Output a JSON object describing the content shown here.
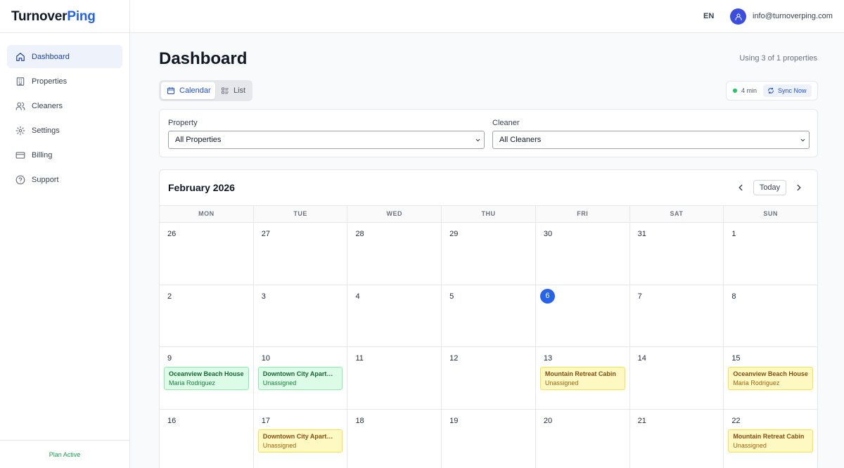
{
  "brand": {
    "part1": "Turnover",
    "part2": "Ping",
    "accent": "#2563eb"
  },
  "sidebar": {
    "items": [
      {
        "label": "Dashboard",
        "icon": "home-icon",
        "active": true
      },
      {
        "label": "Properties",
        "icon": "building-icon",
        "active": false
      },
      {
        "label": "Cleaners",
        "icon": "users-icon",
        "active": false
      },
      {
        "label": "Settings",
        "icon": "gear-icon",
        "active": false
      },
      {
        "label": "Billing",
        "icon": "credit-card-icon",
        "active": false
      },
      {
        "label": "Support",
        "icon": "help-circle-icon",
        "active": false
      }
    ],
    "footer": "Plan Active"
  },
  "header": {
    "language": "EN",
    "email": "info@turnoverping.com"
  },
  "main": {
    "title": "Dashboard",
    "usage": "Using 3 of 1 properties",
    "views": [
      {
        "label": "Calendar",
        "icon": "calendar-icon",
        "active": true
      },
      {
        "label": "List",
        "icon": "list-icon",
        "active": false
      }
    ],
    "sync": {
      "age": "4 min",
      "button": "Sync Now",
      "status_color": "#22c55e"
    }
  },
  "filters": {
    "property": {
      "label": "Property",
      "value": "All Properties"
    },
    "cleaner": {
      "label": "Cleaner",
      "value": "All Cleaners"
    }
  },
  "calendar": {
    "month": "February 2026",
    "today_label": "Today",
    "weekdays": [
      "MON",
      "TUE",
      "WED",
      "THU",
      "FRI",
      "SAT",
      "SUN"
    ],
    "weeks": [
      [
        {
          "day": "26"
        },
        {
          "day": "27"
        },
        {
          "day": "28"
        },
        {
          "day": "29"
        },
        {
          "day": "30"
        },
        {
          "day": "31"
        },
        {
          "day": "1"
        }
      ],
      [
        {
          "day": "2"
        },
        {
          "day": "3"
        },
        {
          "day": "4"
        },
        {
          "day": "5"
        },
        {
          "day": "6",
          "today": true
        },
        {
          "day": "7"
        },
        {
          "day": "8"
        }
      ],
      [
        {
          "day": "9",
          "event": {
            "title": "Oceanview Beach House",
            "sub": "Maria Rodriguez",
            "color": "green"
          }
        },
        {
          "day": "10",
          "event": {
            "title": "Downtown City Apartment",
            "sub": "Unassigned",
            "color": "green"
          }
        },
        {
          "day": "11"
        },
        {
          "day": "12"
        },
        {
          "day": "13",
          "event": {
            "title": "Mountain Retreat Cabin",
            "sub": "Unassigned",
            "color": "yellow"
          }
        },
        {
          "day": "14"
        },
        {
          "day": "15",
          "event": {
            "title": "Oceanview Beach House",
            "sub": "Maria Rodriguez",
            "color": "yellow"
          }
        }
      ],
      [
        {
          "day": "16"
        },
        {
          "day": "17",
          "event": {
            "title": "Downtown City Apartment",
            "sub": "Unassigned",
            "color": "yellow"
          }
        },
        {
          "day": "18"
        },
        {
          "day": "19"
        },
        {
          "day": "20"
        },
        {
          "day": "21"
        },
        {
          "day": "22",
          "event": {
            "title": "Mountain Retreat Cabin",
            "sub": "Unassigned",
            "color": "yellow"
          }
        }
      ]
    ]
  }
}
